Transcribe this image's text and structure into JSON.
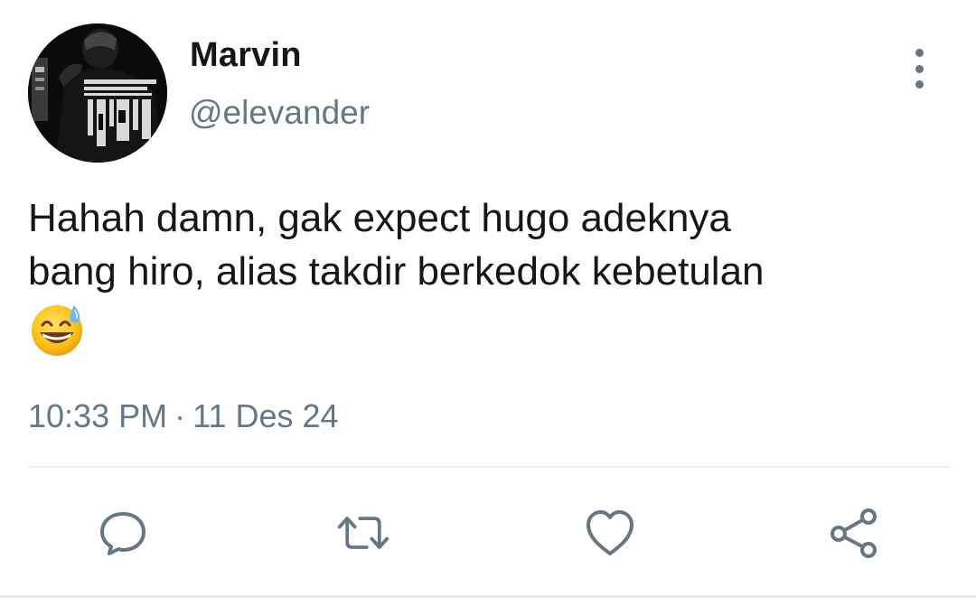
{
  "user": {
    "display_name": "Marvin",
    "handle": "@elevander",
    "avatar_icon": "profile-photo"
  },
  "tweet": {
    "text_lines": [
      "Hahah damn, gak expect hugo adeknya",
      "bang hiro, alias takdir berkedok kebetulan"
    ],
    "emoji": "grinning-face-with-sweat",
    "time": "10:33 PM",
    "separator": "·",
    "date": "11 Des 24"
  },
  "actions": {
    "reply_icon": "speech-bubble-icon",
    "retweet_icon": "retweet-icon",
    "like_icon": "heart-icon",
    "share_icon": "share-icon",
    "more_icon": "vertical-ellipsis-icon"
  },
  "colors": {
    "text_primary": "#14171a",
    "text_secondary": "#657786",
    "divider": "#e6ecf0"
  }
}
